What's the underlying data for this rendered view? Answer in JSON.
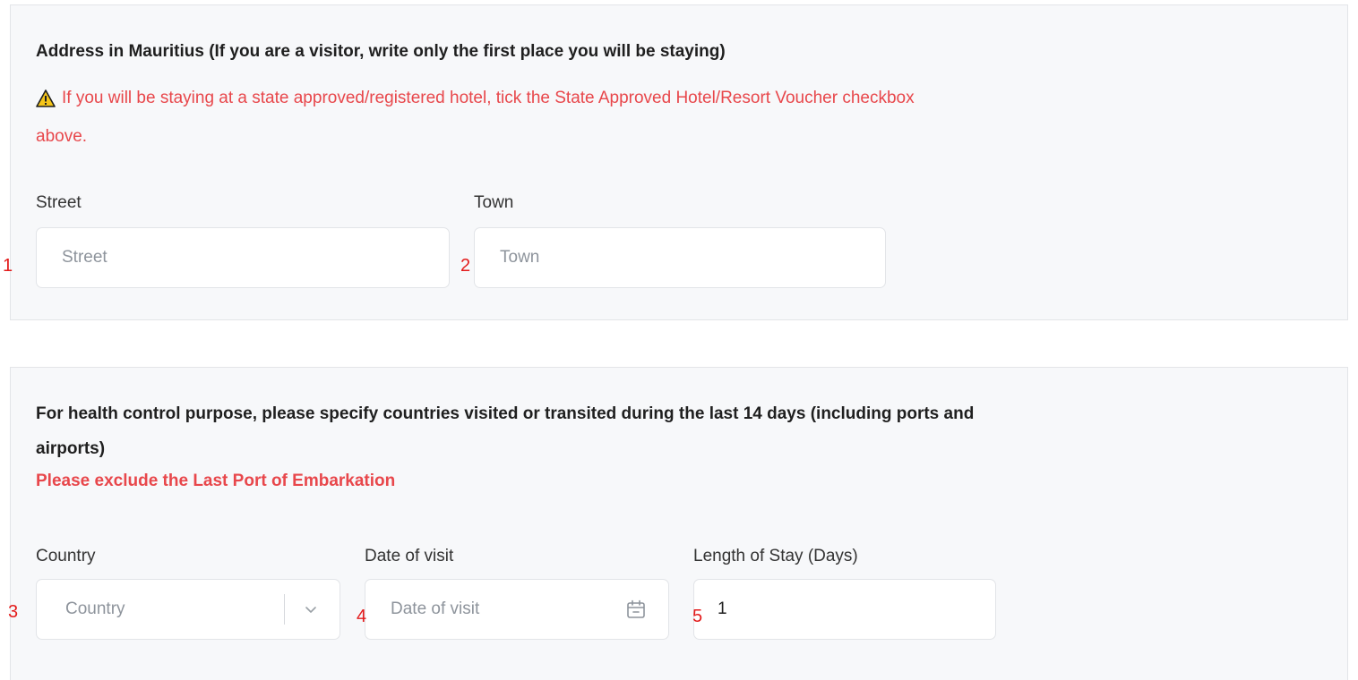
{
  "address_section": {
    "title": "Address in Mauritius (If you are a visitor, write only the first place you will be staying)",
    "warning_line1": "If you will be staying at a state approved/registered hotel, tick the State Approved Hotel/Resort Voucher checkbox",
    "warning_line2": "above.",
    "warning_icon": "warning-triangle-icon",
    "street": {
      "label": "Street",
      "placeholder": "Street",
      "marker": "1"
    },
    "town": {
      "label": "Town",
      "placeholder": "Town",
      "marker": "2"
    }
  },
  "health_section": {
    "title_line1": "For health control purpose, please specify countries visited or transited during the last 14 days (including ports and",
    "title_line2": "airports)",
    "note": "Please exclude the Last Port of Embarkation",
    "country": {
      "label": "Country",
      "placeholder": "Country",
      "marker": "3",
      "icon": "chevron-down-icon"
    },
    "date_of_visit": {
      "label": "Date of visit",
      "placeholder": "Date of visit",
      "marker": "4",
      "icon": "calendar-icon"
    },
    "length_of_stay": {
      "label": "Length of Stay (Days)",
      "value": "1",
      "marker": "5"
    }
  },
  "colors": {
    "warning_red": "#e8474b",
    "marker_red": "#e31b1b",
    "panel_bg": "#f7f8fa"
  }
}
